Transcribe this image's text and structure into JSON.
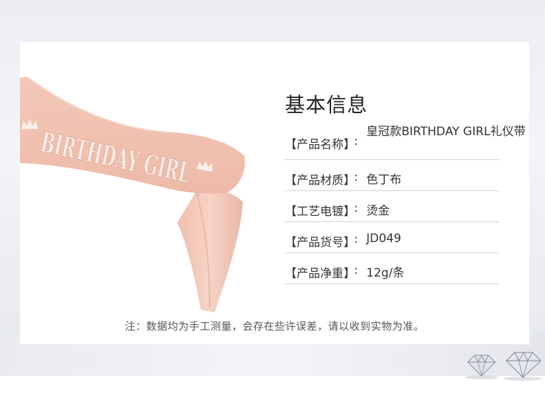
{
  "info": {
    "title": "基本信息",
    "rows": [
      {
        "label": "【产品名称】",
        "colon": ":",
        "value": "皇冠款BIRTHDAY GIRL礼仪带"
      },
      {
        "label": "【产品材质】",
        "colon": ":",
        "value": "色丁布"
      },
      {
        "label": "【工艺电镀】",
        "colon": ":",
        "value": "烫金"
      },
      {
        "label": "【产品货号】",
        "colon": ":",
        "value": "JD049"
      },
      {
        "label": "【产品净重】",
        "colon": ":",
        "value": "12g/条"
      }
    ]
  },
  "note": "注：数据均为手工测量，会存在些许误差，请以收到实物为准。",
  "sash": {
    "text": "BIRTHDAY GIRL",
    "color": "#f2c4b4",
    "text_color": "#fbeee8"
  },
  "colors": {
    "divider": "#cfcfcf",
    "title": "#222222"
  },
  "icons": [
    "crown-icon",
    "diamond-icon"
  ]
}
